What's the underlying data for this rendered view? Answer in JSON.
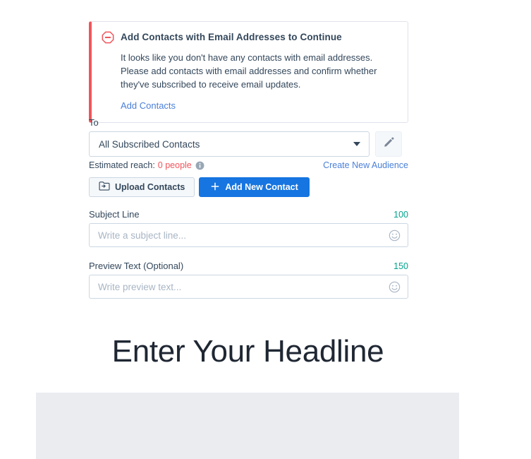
{
  "alert": {
    "icon": "error-octagon-minus-icon",
    "title": "Add Contacts with Email Addresses to Continue",
    "body": "It looks like you don't have any contacts with email addresses. Please add contacts with email addresses and confirm whether they've subscribed to receive email updates.",
    "link_label": "Add Contacts",
    "accent_color": "#f2545b",
    "link_color": "#4a7fd8"
  },
  "form": {
    "to": {
      "label": "To",
      "selected": "All Subscribed Contacts",
      "caret_icon": "chevron-down-icon",
      "edit_icon": "pencil-icon"
    },
    "reach": {
      "label": "Estimated reach:",
      "count": "0 people",
      "count_color": "#f2545b",
      "info_icon": "info-circle-icon",
      "audience_link": "Create New Audience"
    },
    "buttons": {
      "upload": {
        "label": "Upload Contacts",
        "icon": "folder-upload-icon"
      },
      "add": {
        "label": "Add New Contact",
        "icon": "plus-icon",
        "color": "#1675e0"
      }
    },
    "subject": {
      "label": "Subject Line",
      "char_count": "100",
      "placeholder": "Write a subject line...",
      "emoji_icon": "smiley-face-icon",
      "value": ""
    },
    "preview_text": {
      "label": "Preview Text (Optional)",
      "char_count": "150",
      "placeholder": "Write preview text...",
      "emoji_icon": "smiley-face-icon",
      "value": ""
    },
    "counter_color": "#00a38d"
  },
  "preview": {
    "headline": "Enter Your Headline"
  }
}
